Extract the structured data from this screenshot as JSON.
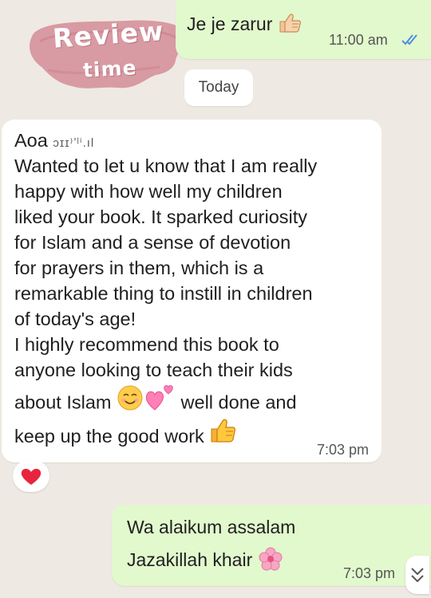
{
  "sticker": {
    "line1": "Review",
    "line2": "time"
  },
  "messages": [
    {
      "text": "Je je zarur",
      "time": "11:00 am"
    }
  ],
  "date_chip": "Today",
  "incoming": {
    "greeting": "Aoa",
    "lines": [
      "Wanted to let u know that I am really",
      "happy with how well my children",
      "liked your book. It sparked curiosity",
      "for Islam and a sense of devotion",
      "for prayers in them, which is a",
      "remarkable thing to instill in children",
      "of today's age!",
      "I highly recommend this book to",
      "anyone looking to teach their kids"
    ],
    "line10_a": "about Islam",
    "line10_b": "well done and",
    "line11": "keep up the good work",
    "time": "7:03 pm"
  },
  "reply": {
    "line1": "Wa alaikum assalam",
    "line2": "Jazakillah khair",
    "time": "7:03 pm"
  },
  "colors": {
    "background": "#efe9e3",
    "outgoing_bubble": "#e2f8cd",
    "incoming_bubble": "#ffffff",
    "read_ticks": "#4f8fe0",
    "sticker_pink": "#d89aa3"
  },
  "icons": [
    "thumbs-up-icon",
    "read-receipt-icon",
    "smiling-face-icon",
    "two-hearts-icon",
    "red-heart-icon",
    "cherry-blossom-icon",
    "scroll-down-icon"
  ]
}
